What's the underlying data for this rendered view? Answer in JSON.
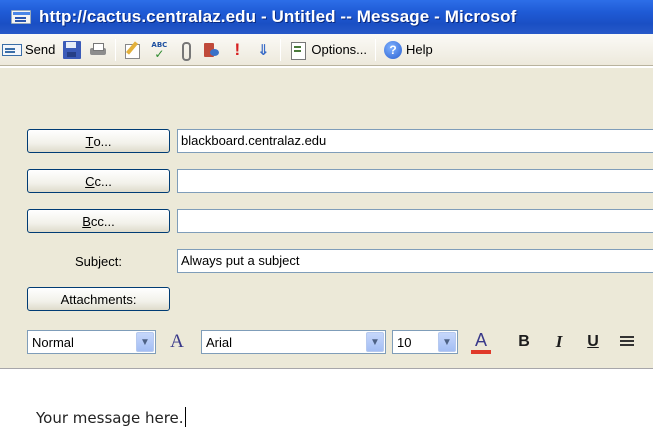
{
  "window": {
    "title": "http://cactus.centralaz.edu - Untitled -- Message - Microsof"
  },
  "toolbar": {
    "send_label": "Send",
    "options_label": "Options...",
    "help_label": "Help",
    "spell_icon_text": "ABC",
    "exclaim_icon_text": "!",
    "down_icon_text": "⇓",
    "help_icon_text": "?",
    "icons": [
      "send-icon",
      "save-icon",
      "print-icon",
      "edit-icon",
      "spellcheck-icon",
      "paperclip-icon",
      "address-book-icon",
      "importance-high-icon",
      "importance-low-icon",
      "options-icon",
      "help-icon"
    ]
  },
  "header_fields": {
    "to": {
      "button_mnemonic": "T",
      "button_rest": "o...",
      "value": "blackboard.centralaz.edu"
    },
    "cc": {
      "button_mnemonic": "C",
      "button_rest": "c...",
      "value": ""
    },
    "bcc": {
      "button_mnemonic": "B",
      "button_rest": "cc...",
      "value": ""
    },
    "subject": {
      "label": "Subject:",
      "value": "Always put a subject"
    },
    "attachments": {
      "button_label": "Attachments:"
    }
  },
  "format_bar": {
    "style_value": "Normal",
    "font_value": "Arial",
    "size_value": "10",
    "font_icon_text": "A",
    "color_icon_text": "A",
    "bold_text": "B",
    "italic_text": "I",
    "underline_text": "U",
    "colors": {
      "font_color_bar": "#e03a2a",
      "dropdown": "#a4bef4"
    }
  },
  "message": {
    "body": "Your message here."
  },
  "colors": {
    "titlebar": "#1f5bd6",
    "form_background": "#ece9d8",
    "button_border": "#003c74"
  }
}
